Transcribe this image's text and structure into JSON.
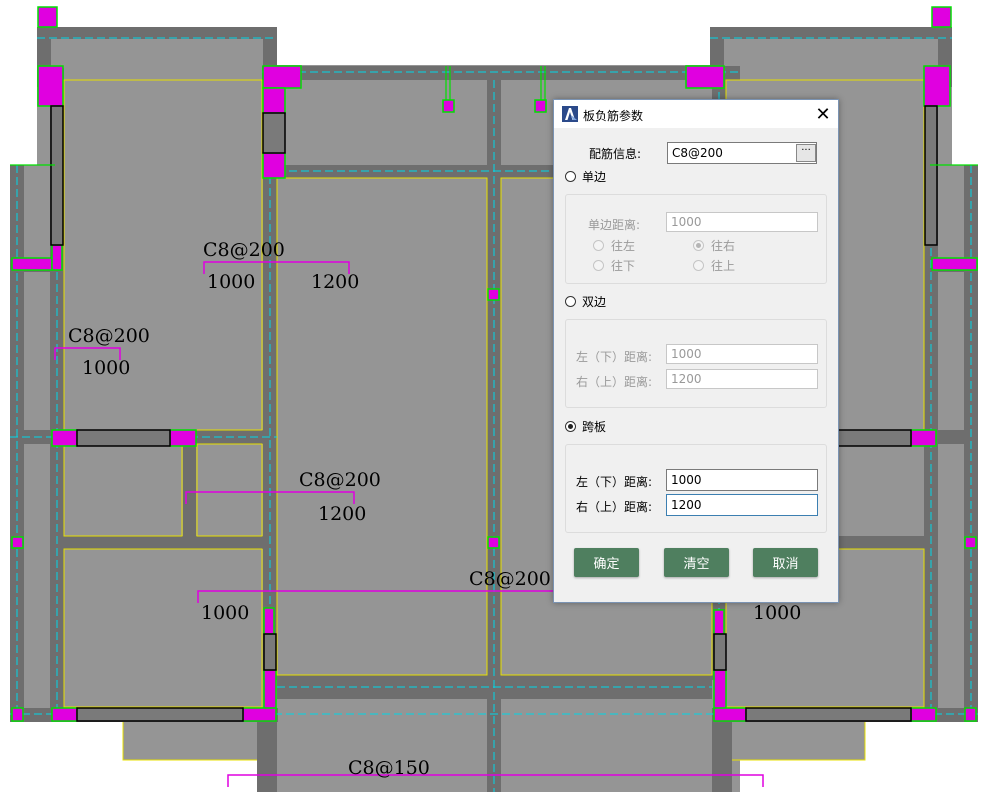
{
  "drawing": {
    "annotations": [
      {
        "id": "ann1a",
        "text": "C8@200"
      },
      {
        "id": "ann1b",
        "text": "1000"
      },
      {
        "id": "ann1c",
        "text": "1200"
      },
      {
        "id": "ann2a",
        "text": "C8@200"
      },
      {
        "id": "ann2b",
        "text": "1000"
      },
      {
        "id": "ann3a",
        "text": "C8@200"
      },
      {
        "id": "ann3b",
        "text": "1200"
      },
      {
        "id": "ann4a",
        "text": "C8@200"
      },
      {
        "id": "ann4b",
        "text": "1000"
      },
      {
        "id": "ann5",
        "text": "1000"
      },
      {
        "id": "ann6",
        "text": "C8@150"
      }
    ],
    "colors": {
      "slab": "#959595",
      "wall": "#6e6e6e",
      "column": "#e000e0",
      "rebar": "#e000e0",
      "outline": "#00e000",
      "axis": "#00d8e8",
      "edge": "#e8e000"
    }
  },
  "dialog": {
    "title": "板负筋参数",
    "close_label": "✕",
    "rebar_info_label": "配筋信息:",
    "rebar_info_value": "C8@200",
    "browse_label": "···",
    "single_side": {
      "label": "单边",
      "distance_label": "单边距离:",
      "distance_value": "1000",
      "options": [
        "往左",
        "往右",
        "往下",
        "往上"
      ],
      "selected": "往右"
    },
    "double_side": {
      "label": "双边",
      "left_label": "左（下）距离:",
      "left_value": "1000",
      "right_label": "右（上）距离:",
      "right_value": "1200"
    },
    "span": {
      "label": "跨板",
      "left_label": "左（下）距离:",
      "left_value": "1000",
      "right_label": "右（上）距离:",
      "right_value": "1200"
    },
    "selected_mode": "跨板",
    "buttons": {
      "ok": "确定",
      "clear": "清空",
      "cancel": "取消"
    },
    "button_color": "#4f7f5f"
  }
}
